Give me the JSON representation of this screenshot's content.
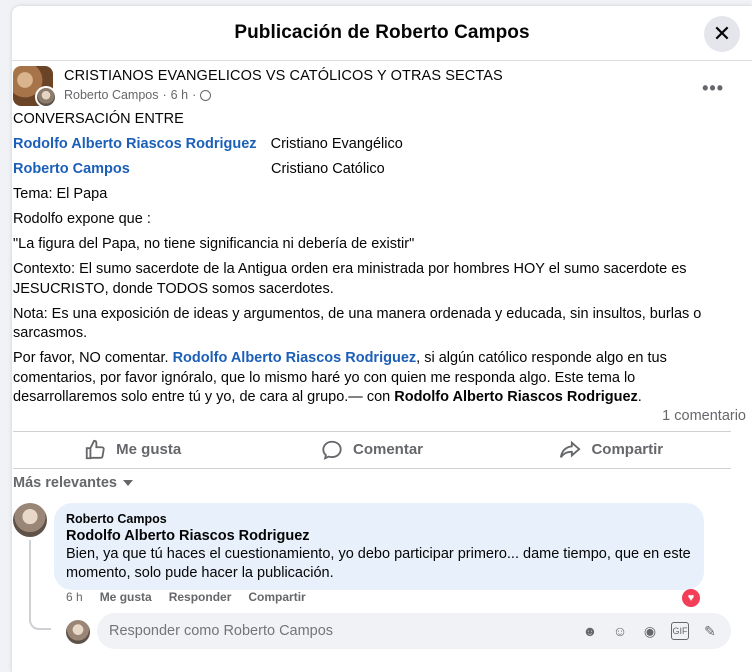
{
  "header": {
    "title": "Publicación de Roberto Campos",
    "close_icon": "close-icon"
  },
  "post": {
    "group_name": "CRISTIANOS EVANGELICOS VS CATÓLICOS Y OTRAS SECTAS",
    "author": "Roberto Campos",
    "time": "6 h",
    "visibility_icon": "globe-icon",
    "line_title": "CONVERSACIÓN ENTRE",
    "person1_name": "Rodolfo Alberto Riascos Rodriguez",
    "person1_role": "Cristiano Evangélico",
    "person2_name": "Roberto Campos",
    "person2_role": "Cristiano Católico",
    "topic": "Tema: El Papa",
    "exposes": "Rodolfo expone que :",
    "quote": "\"La figura del Papa, no tiene significancia ni debería de existir\"",
    "context": "Contexto: El sumo sacerdote de la Antigua orden era ministrada por hombres HOY el sumo sacerdote es JESUCRISTO, donde TODOS somos sacerdotes.",
    "note": "Nota: Es una exposición de ideas y argumentos, de una manera ordenada y educada, sin insultos, burlas o sarcasmos.",
    "request_prefix": "Por favor, NO comentar.",
    "request_mention": "Rodolfo Alberto Riascos Rodriguez",
    "request_middle": ", si algún católico responde algo en tus comentarios, por favor ignóralo, que lo mismo haré yo con quien me responda algo. Este tema lo desarrollaremos solo entre tú y yo, de cara al grupo.— con",
    "request_tagged": "Rodolfo Alberto Riascos Rodriguez",
    "request_end": ".",
    "comment_count": "1 comentario"
  },
  "actions": {
    "like": "Me gusta",
    "comment": "Comentar",
    "share": "Compartir"
  },
  "comments": {
    "sort_label": "Más relevantes",
    "items": [
      {
        "author": "Roberto Campos",
        "tagged": "Rodolfo Alberto Riascos Rodriguez",
        "text": "Bien, ya que tú haces el cuestionamiento, yo debo participar primero... dame tiempo, que en este momento, solo pude hacer la publicación.",
        "time": "6 h",
        "like": "Me gusta",
        "reply": "Responder",
        "share": "Compartir",
        "reaction_icon": "love-icon"
      }
    ],
    "reply_placeholder": "Responder como Roberto Campos"
  },
  "colors": {
    "link": "#1b5fb8",
    "bubble": "#e8f1fb",
    "muted": "#65676b"
  }
}
